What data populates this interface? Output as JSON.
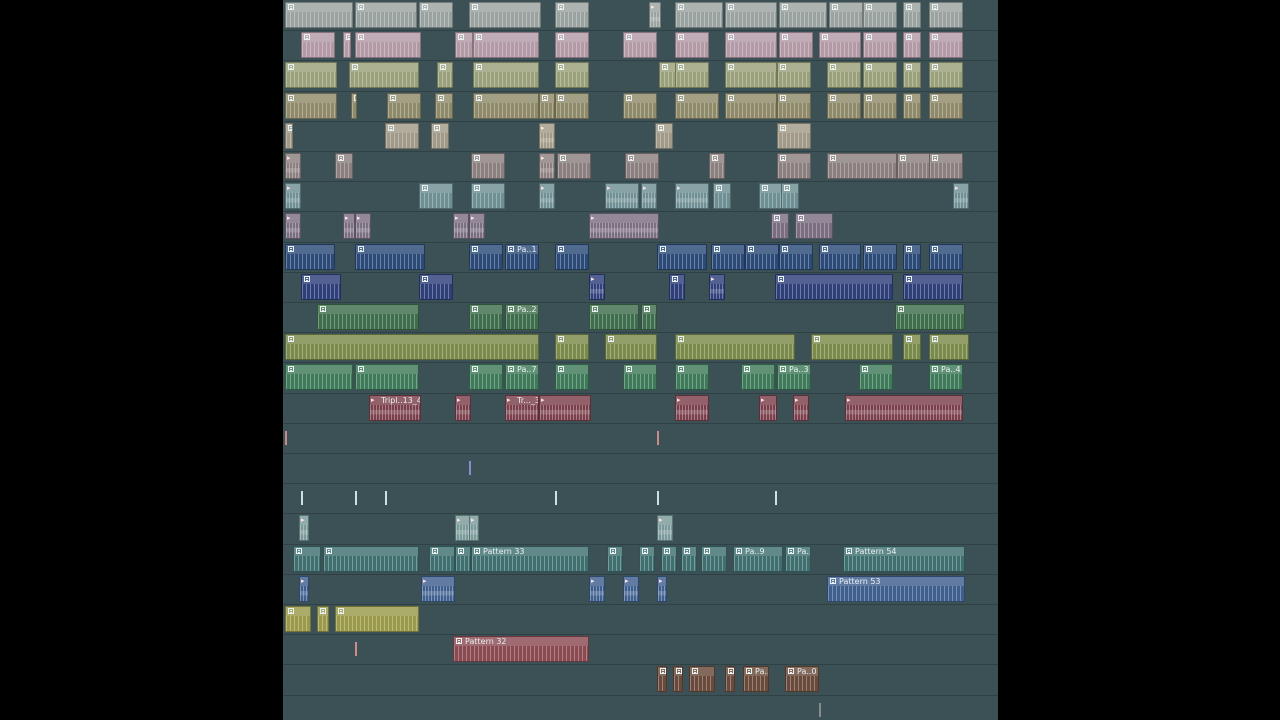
{
  "playlist": {
    "background_color": "#3c5156",
    "lane_count": 24,
    "icons": {
      "pattern": "pattern-clip-icon",
      "audio": "audio-clip-icon"
    },
    "clip_labels": {
      "pa_1": "Pa..1",
      "pa_2": "Pa..2",
      "pa_7": "Pa..7",
      "pa_3": "Pa..3",
      "pa_4": "Pa..4",
      "tripl_13_4": "Tripl..13_4",
      "tr_3": "Tr..._3",
      "pattern_33": "Pattern 33",
      "pa_9": "Pa..9",
      "pa_1b": "Pa..1",
      "pattern_54": "Pattern 54",
      "pattern_53": "Pattern 53",
      "pattern_32": "Pattern 32",
      "pa_8": "Pa..8",
      "pa_0": "Pa..0"
    },
    "lane_colors": [
      "#9aa3a0",
      "#b39aa6",
      "#9aa07a",
      "#8f8a6a",
      "#a29a88",
      "#8c7f7f",
      "#6e8f93",
      "#7a6e80",
      "#2b4a78",
      "#2e3f7a",
      "#3f6e4c",
      "#7a8a4a",
      "#3f7a5a",
      "#7a3f4a",
      "#5a6f6f",
      "#4f6f8f",
      "#6f8f8a",
      "#7a9a9a",
      "#3f6f6f",
      "#3f5f8f",
      "#9a9a4a",
      "#8a4a52",
      "#6a4a3a",
      "#5a6a6a"
    ]
  }
}
